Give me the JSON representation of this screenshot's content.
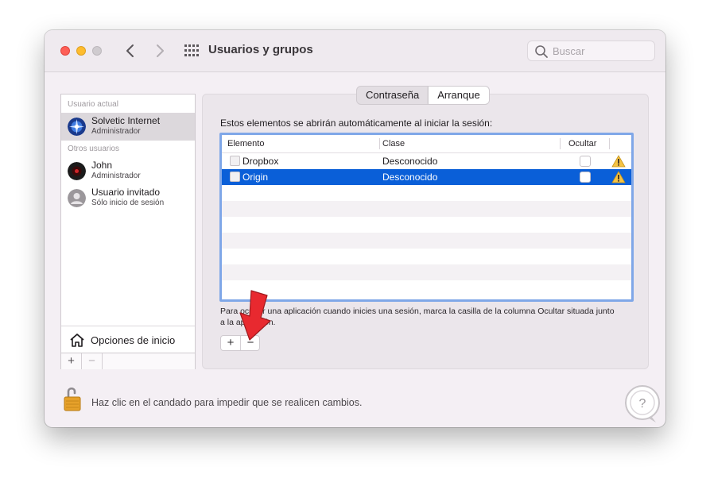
{
  "window": {
    "title": "Usuarios y grupos",
    "search_placeholder": "Buscar"
  },
  "sidebar": {
    "current_user_header": "Usuario actual",
    "other_users_header": "Otros usuarios",
    "users": [
      {
        "name": "Solvetic Internet",
        "role": "Administrador",
        "selected": true
      },
      {
        "name": "John",
        "role": "Administrador",
        "selected": false
      },
      {
        "name": "Usuario invitado",
        "role": "Sólo inicio de sesión",
        "selected": false
      }
    ],
    "login_options_label": "Opciones de inicio",
    "add_label": "+",
    "remove_label": "−"
  },
  "tabs": [
    {
      "label": "Contraseña",
      "active": false
    },
    {
      "label": "Arranque",
      "active": true
    }
  ],
  "login_items": {
    "intro": "Estos elementos se abrirán automáticamente al iniciar la sesión:",
    "columns": [
      "Elemento",
      "Clase",
      "Ocultar"
    ],
    "rows": [
      {
        "item": "Dropbox",
        "kind": "Desconocido",
        "hide": false,
        "selected": false,
        "warning": true
      },
      {
        "item": "Origin",
        "kind": "Desconocido",
        "hide": false,
        "selected": true,
        "warning": true
      }
    ],
    "hint": "Para ocultar una aplicación cuando inicies una sesión, marca la casilla de la columna Ocultar situada junto a la aplicación.",
    "add_label": "+",
    "remove_label": "−"
  },
  "footer": {
    "lock_text": "Haz clic en el candado para impedir que se realicen cambios."
  },
  "colors": {
    "selection": "#0a5fd8",
    "close": "#fe5f57",
    "minimize": "#febc2e",
    "pointer_arrow": "#e8292f"
  }
}
